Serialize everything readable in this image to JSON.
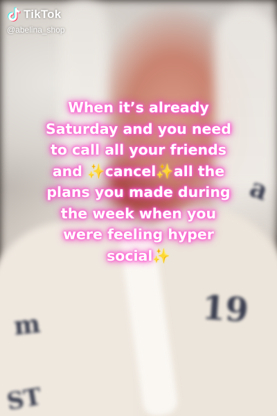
{
  "watermark": {
    "brand": "TikTok",
    "handle": "@abelina_shop",
    "icon": "tiktok-logo-icon"
  },
  "caption": {
    "lines": [
      "When it’s already",
      "Saturday and you need",
      "to call all your friends",
      [
        "and ",
        "✨",
        "cancel",
        "✨",
        "all the"
      ],
      "plans you made during",
      "the week when you",
      "were feeling hyper",
      [
        "social",
        "✨"
      ]
    ]
  },
  "background": {
    "scribbles": [
      "m",
      "19",
      "ST",
      "a"
    ]
  },
  "colors": {
    "caption_text": "#ffffff",
    "caption_glow": "#ff49c9",
    "sparkle": "#ffd84a"
  }
}
